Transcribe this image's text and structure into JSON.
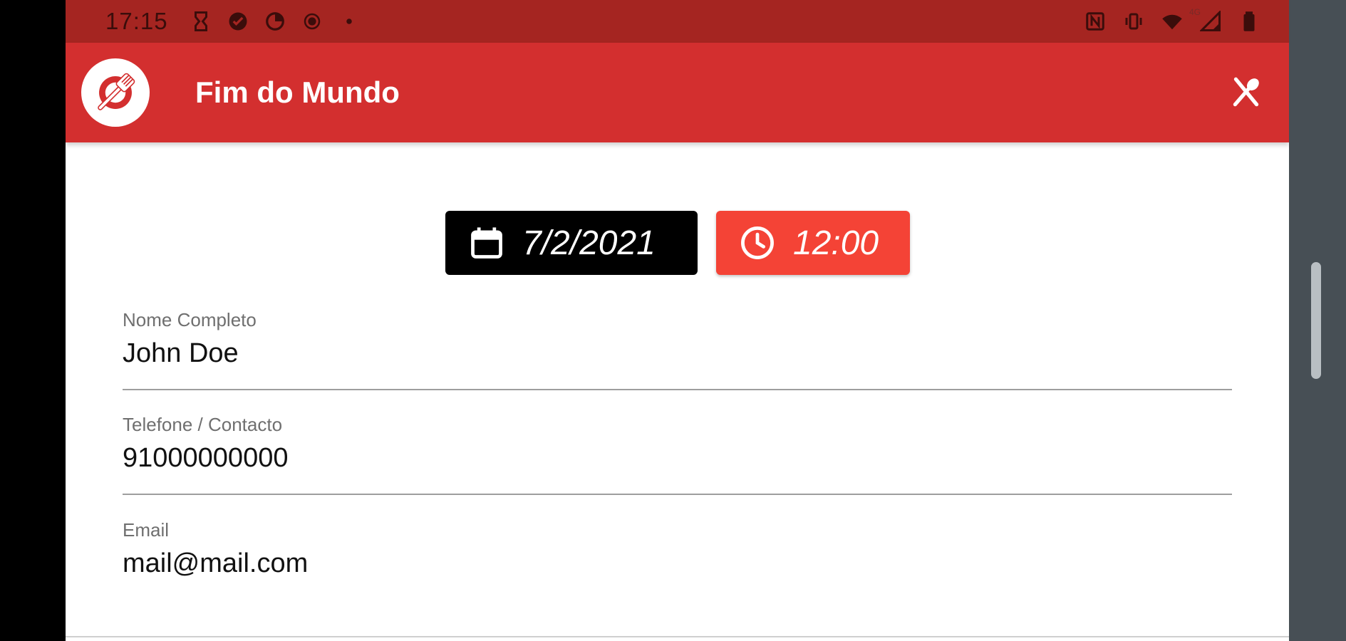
{
  "status_bar": {
    "time": "17:15",
    "left_icons": [
      "hourglass-icon",
      "check-circle-icon",
      "data-saver-icon",
      "record-icon",
      "dot-icon"
    ],
    "right_icons": [
      "nfc-icon",
      "vibrate-icon",
      "wifi-icon",
      "signal-4g-icon",
      "battery-icon"
    ],
    "network_label": "4G"
  },
  "app_bar": {
    "title": "Fim do Mundo",
    "logo_icon": "plate-fork-icon",
    "action_icon": "cutlery-icon"
  },
  "reservation": {
    "date": "7/2/2021",
    "time": "12:00",
    "date_icon": "calendar-icon",
    "time_icon": "clock-icon"
  },
  "form": {
    "name_label": "Nome Completo",
    "name_value": "John Doe",
    "phone_label": "Telefone / Contacto",
    "phone_value": "91000000000",
    "email_label": "Email",
    "email_value": "mail@mail.com"
  },
  "colors": {
    "status_bar": "#a52521",
    "app_bar": "#d32f2f",
    "time_chip": "#f44336",
    "date_chip": "#000000"
  }
}
